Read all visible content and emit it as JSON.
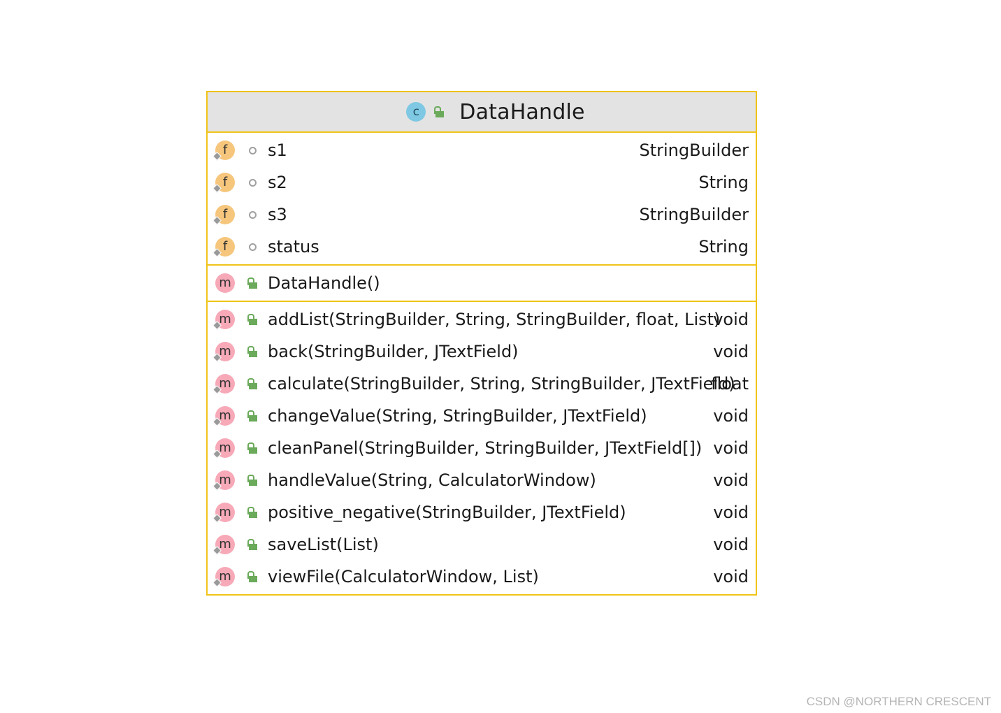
{
  "class": {
    "name": "DataHandle",
    "kind_icon": "class-icon",
    "visibility_icon": "public-lock-icon"
  },
  "fields": [
    {
      "name": "s1",
      "type": "StringBuilder",
      "icon": "field-icon",
      "visibility": "package-private-icon"
    },
    {
      "name": "s2",
      "type": "String",
      "icon": "field-icon",
      "visibility": "package-private-icon"
    },
    {
      "name": "s3",
      "type": "StringBuilder",
      "icon": "field-icon",
      "visibility": "package-private-icon"
    },
    {
      "name": "status",
      "type": "String",
      "icon": "field-icon",
      "visibility": "package-private-icon"
    }
  ],
  "constructors": [
    {
      "name": "DataHandle()",
      "icon": "method-icon",
      "visibility": "public-lock-icon"
    }
  ],
  "methods": [
    {
      "name": "addList(StringBuilder, String, StringBuilder, float, List)",
      "type": "void"
    },
    {
      "name": "back(StringBuilder, JTextField)",
      "type": "void"
    },
    {
      "name": "calculate(StringBuilder, String, StringBuilder, JTextField)",
      "type": "float"
    },
    {
      "name": "changeValue(String, StringBuilder, JTextField)",
      "type": "void"
    },
    {
      "name": "cleanPanel(StringBuilder, StringBuilder, JTextField[])",
      "type": "void"
    },
    {
      "name": "handleValue(String, CalculatorWindow)",
      "type": "void"
    },
    {
      "name": "positive_negative(StringBuilder, JTextField)",
      "type": "void"
    },
    {
      "name": "saveList(List)",
      "type": "void"
    },
    {
      "name": "viewFile(CalculatorWindow, List)",
      "type": "void"
    }
  ],
  "badges": {
    "class_letter": "c",
    "field_letter": "f",
    "method_letter": "m"
  },
  "colors": {
    "border": "#f0c419",
    "header_bg": "#e3e3e3",
    "field_badge": "#f6c67c",
    "method_badge": "#f7a9b8",
    "class_badge": "#7ec8e3",
    "public_lock": "#6aaa5a"
  },
  "watermark": "CSDN @NORTHERN  CRESCENT"
}
